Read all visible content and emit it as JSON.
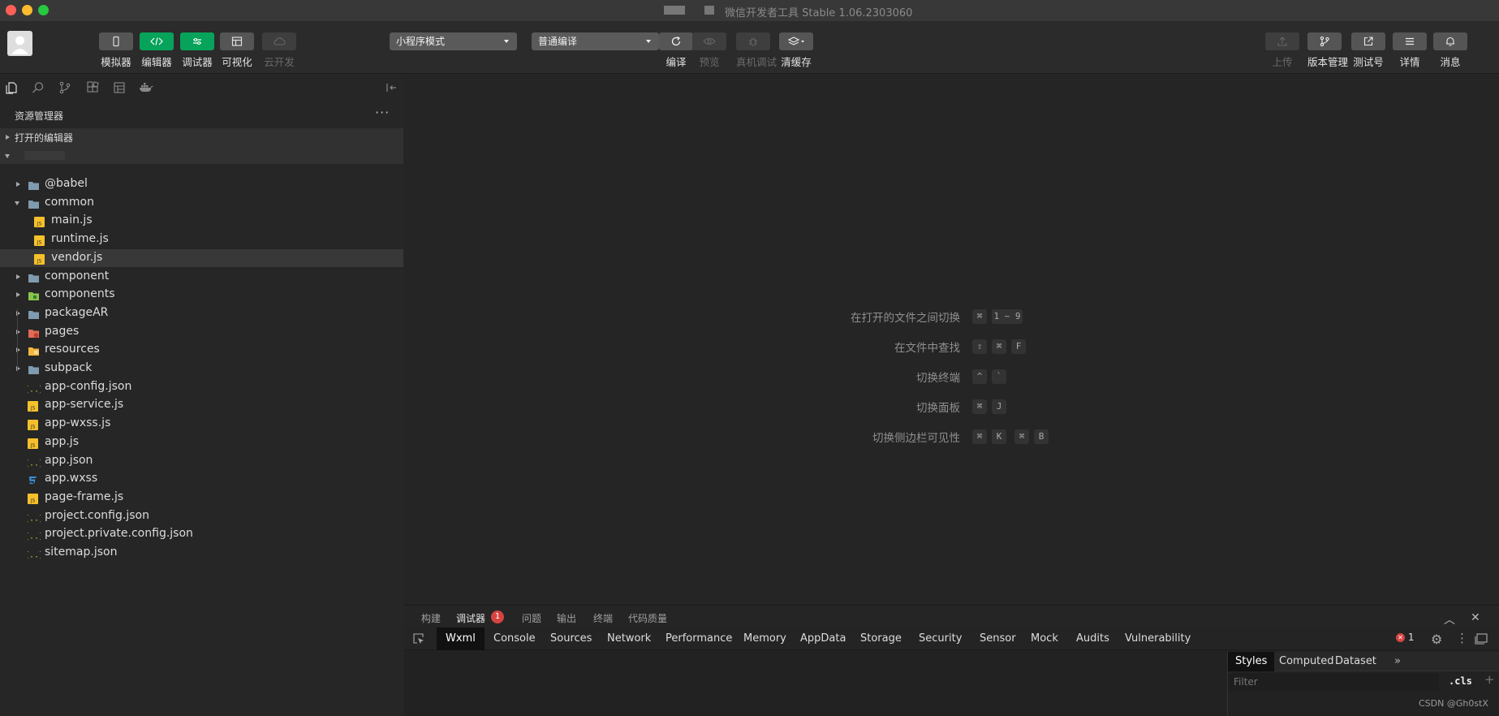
{
  "window": {
    "title": "微信开发者工具 Stable 1.06.2303060"
  },
  "toolbar": {
    "left_buttons": [
      {
        "label": "模拟器",
        "icon": "phone-icon",
        "state": "normal"
      },
      {
        "label": "编辑器",
        "icon": "code-icon",
        "state": "active"
      },
      {
        "label": "调试器",
        "icon": "debug-toggle-icon",
        "state": "active"
      },
      {
        "label": "可视化",
        "icon": "layout-icon",
        "state": "normal"
      },
      {
        "label": "云开发",
        "icon": "cloud-icon",
        "state": "disabled"
      }
    ],
    "mode_select": "小程序模式",
    "compile_select": "普通编译",
    "center_buttons": [
      {
        "label": "编译",
        "icon": "refresh-icon",
        "state": "normal"
      },
      {
        "label": "预览",
        "icon": "eye-icon",
        "state": "disabled"
      },
      {
        "label": "真机调试",
        "icon": "bug-icon",
        "state": "disabled"
      },
      {
        "label": "清缓存",
        "icon": "layers-icon",
        "state": "normal"
      }
    ],
    "right_buttons": [
      {
        "label": "上传",
        "icon": "upload-icon",
        "state": "disabled"
      },
      {
        "label": "版本管理",
        "icon": "branch-icon",
        "state": "normal"
      },
      {
        "label": "测试号",
        "icon": "external-link-icon",
        "state": "normal"
      },
      {
        "label": "详情",
        "icon": "menu-icon",
        "state": "normal"
      },
      {
        "label": "消息",
        "icon": "bell-icon",
        "state": "normal"
      }
    ]
  },
  "explorer": {
    "title": "资源管理器",
    "more": "···",
    "open_editors": "打开的编辑器",
    "tree": [
      {
        "name": "@babel",
        "type": "folder",
        "depth": 1,
        "expanded": false,
        "icon": "folder-icon",
        "color": "#7f9bb0"
      },
      {
        "name": "common",
        "type": "folder",
        "depth": 1,
        "expanded": true,
        "icon": "folder-open-icon",
        "color": "#7f9bb0"
      },
      {
        "name": "main.js",
        "type": "js",
        "depth": 2,
        "icon": "js-file-icon"
      },
      {
        "name": "runtime.js",
        "type": "js",
        "depth": 2,
        "icon": "js-file-icon"
      },
      {
        "name": "vendor.js",
        "type": "js",
        "depth": 2,
        "selected": true,
        "icon": "js-file-icon"
      },
      {
        "name": "component",
        "type": "folder",
        "depth": 1,
        "expanded": false,
        "icon": "folder-icon",
        "color": "#7f9bb0"
      },
      {
        "name": "components",
        "type": "folder",
        "depth": 1,
        "expanded": false,
        "icon": "components-folder-icon",
        "color": "#8bc34a"
      },
      {
        "name": "packageAR",
        "type": "folder",
        "depth": 1,
        "expanded": false,
        "icon": "folder-icon",
        "color": "#7f9bb0"
      },
      {
        "name": "pages",
        "type": "folder",
        "depth": 1,
        "expanded": false,
        "icon": "pages-folder-icon",
        "color": "#e06c56"
      },
      {
        "name": "resources",
        "type": "folder",
        "depth": 1,
        "expanded": false,
        "icon": "resources-folder-icon",
        "color": "#f4b73e"
      },
      {
        "name": "subpack",
        "type": "folder",
        "depth": 1,
        "expanded": false,
        "icon": "folder-icon",
        "color": "#7f9bb0"
      },
      {
        "name": "app-config.json",
        "type": "json",
        "depth": 1,
        "icon": "json-file-icon"
      },
      {
        "name": "app-service.js",
        "type": "js",
        "depth": 1,
        "icon": "js-file-icon"
      },
      {
        "name": "app-wxss.js",
        "type": "js",
        "depth": 1,
        "icon": "js-file-icon"
      },
      {
        "name": "app.js",
        "type": "js",
        "depth": 1,
        "icon": "js-file-icon"
      },
      {
        "name": "app.json",
        "type": "json",
        "depth": 1,
        "icon": "json-file-icon"
      },
      {
        "name": "app.wxss",
        "type": "css",
        "depth": 1,
        "icon": "css-file-icon"
      },
      {
        "name": "page-frame.js",
        "type": "js",
        "depth": 1,
        "icon": "js-file-icon"
      },
      {
        "name": "project.config.json",
        "type": "json",
        "depth": 1,
        "icon": "json-file-icon"
      },
      {
        "name": "project.private.config.json",
        "type": "json",
        "depth": 1,
        "icon": "json-file-icon"
      },
      {
        "name": "sitemap.json",
        "type": "json",
        "depth": 1,
        "icon": "json-file-icon"
      }
    ]
  },
  "shortcuts": [
    {
      "label": "在打开的文件之间切换",
      "keys": [
        "⌘",
        "1 ~ 9"
      ]
    },
    {
      "label": "在文件中查找",
      "keys": [
        "⇧",
        "⌘",
        "F"
      ]
    },
    {
      "label": "切换终端",
      "keys": [
        "^",
        "`"
      ]
    },
    {
      "label": "切换面板",
      "keys": [
        "⌘",
        "J"
      ]
    },
    {
      "label": "切换侧边栏可见性",
      "keys": [
        "⌘",
        "K",
        "⌘",
        "B"
      ]
    }
  ],
  "panel": {
    "tabs": [
      "构建",
      "调试器",
      "问题",
      "输出",
      "终端",
      "代码质量"
    ],
    "active_tab": "调试器",
    "debugger_badge": "1",
    "devtools_tabs": [
      "Wxml",
      "Console",
      "Sources",
      "Network",
      "Performance",
      "Memory",
      "AppData",
      "Storage",
      "Security",
      "Sensor",
      "Mock",
      "Audits",
      "Vulnerability"
    ],
    "active_devtools_tab": "Wxml",
    "error_count": "1",
    "styles_tabs": [
      "Styles",
      "Computed",
      "Dataset"
    ],
    "active_styles_tab": "Styles",
    "styles_more": "»",
    "filter_placeholder": "Filter",
    "cls": ".cls",
    "plus": "+"
  },
  "watermark": "CSDN @Gh0stX",
  "colors": {
    "accent_green": "#07a35a",
    "error_red": "#d64441",
    "js_yellow": "#f5c02a",
    "json_yellow": "#e8b93a",
    "css_blue": "#3b8fd9"
  }
}
